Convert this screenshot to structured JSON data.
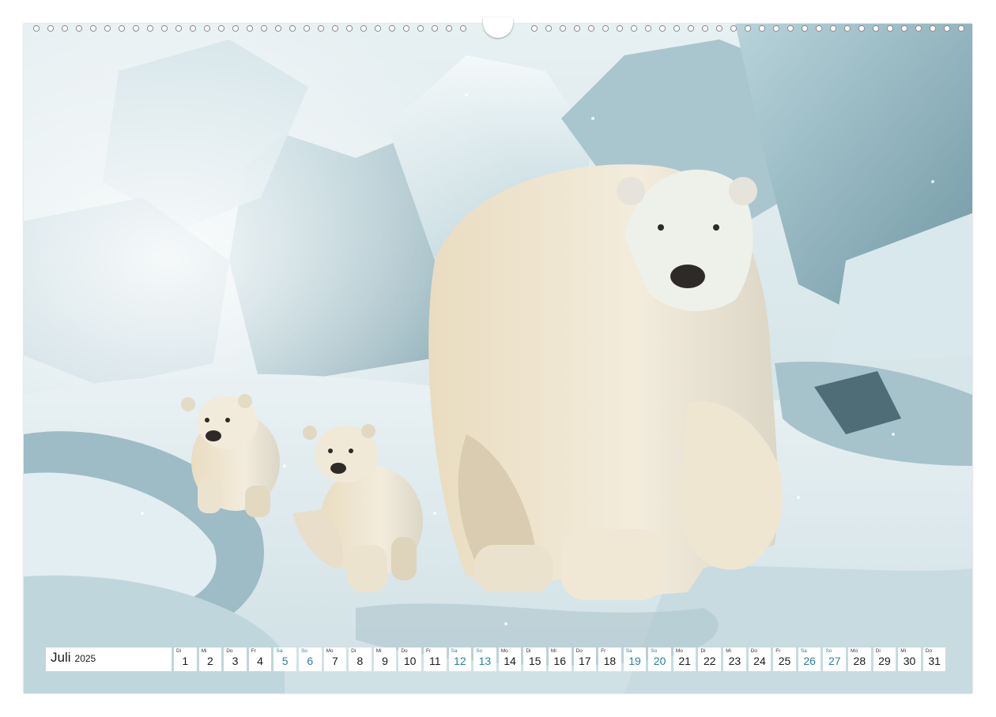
{
  "calendar": {
    "month": "Juli",
    "year": "2025",
    "days": [
      {
        "wd": "Di",
        "d": "1",
        "we": false
      },
      {
        "wd": "Mi",
        "d": "2",
        "we": false
      },
      {
        "wd": "Do",
        "d": "3",
        "we": false
      },
      {
        "wd": "Fr",
        "d": "4",
        "we": false
      },
      {
        "wd": "Sa",
        "d": "5",
        "we": true
      },
      {
        "wd": "So",
        "d": "6",
        "we": true
      },
      {
        "wd": "Mo",
        "d": "7",
        "we": false
      },
      {
        "wd": "Di",
        "d": "8",
        "we": false
      },
      {
        "wd": "Mi",
        "d": "9",
        "we": false
      },
      {
        "wd": "Do",
        "d": "10",
        "we": false
      },
      {
        "wd": "Fr",
        "d": "11",
        "we": false
      },
      {
        "wd": "Sa",
        "d": "12",
        "we": true
      },
      {
        "wd": "So",
        "d": "13",
        "we": true
      },
      {
        "wd": "Mo",
        "d": "14",
        "we": false
      },
      {
        "wd": "Di",
        "d": "15",
        "we": false
      },
      {
        "wd": "Mi",
        "d": "16",
        "we": false
      },
      {
        "wd": "Do",
        "d": "17",
        "we": false
      },
      {
        "wd": "Fr",
        "d": "18",
        "we": false
      },
      {
        "wd": "Sa",
        "d": "19",
        "we": true
      },
      {
        "wd": "So",
        "d": "20",
        "we": true
      },
      {
        "wd": "Mo",
        "d": "21",
        "we": false
      },
      {
        "wd": "Di",
        "d": "22",
        "we": false
      },
      {
        "wd": "Mi",
        "d": "23",
        "we": false
      },
      {
        "wd": "Do",
        "d": "24",
        "we": false
      },
      {
        "wd": "Fr",
        "d": "25",
        "we": false
      },
      {
        "wd": "Sa",
        "d": "26",
        "we": true
      },
      {
        "wd": "So",
        "d": "27",
        "we": true
      },
      {
        "wd": "Mo",
        "d": "28",
        "we": false
      },
      {
        "wd": "Di",
        "d": "29",
        "we": false
      },
      {
        "wd": "Mi",
        "d": "30",
        "we": false
      },
      {
        "wd": "Do",
        "d": "31",
        "we": false
      }
    ]
  },
  "colors": {
    "weekend": "#2a7fa3",
    "text": "#1a1a1a",
    "ice_light": "#eaf3f5",
    "ice_shadow": "#8fb2bd",
    "fur": "#efe7d3"
  }
}
